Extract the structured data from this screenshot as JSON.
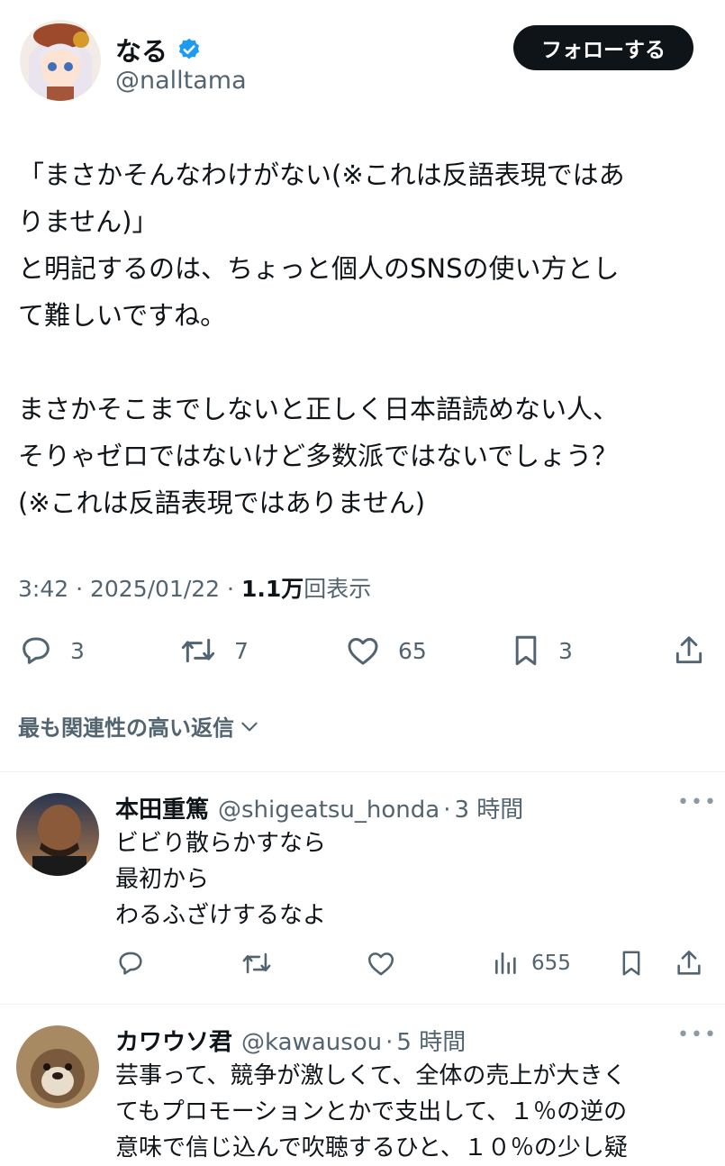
{
  "author": {
    "name": "なる",
    "handle": "@nalltama",
    "verified": true,
    "follow_label": "フォローする"
  },
  "tweet": {
    "line1": "「まさかそんなわけがない(※これは反語表現ではあ",
    "line2": "りません)」",
    "line3": "と明記するのは、ちょっと個人のSNSの使い方とし",
    "line4": "て難しいですね。",
    "line5": "まさかそこまでしないと正しく日本語読めない人、",
    "line6": "そりゃゼロではないけど多数派ではないでしょう？",
    "line7": "(※これは反語表現ではありません)",
    "time": "3:42",
    "date": "2025/01/22",
    "views_count": "1.1万",
    "views_label": "回表示",
    "sep": "·"
  },
  "stats": {
    "replies": "3",
    "retweets": "7",
    "likes": "65",
    "bookmarks": "3"
  },
  "related_label": "最も関連性の高い返信",
  "replies": [
    {
      "name": "本田重篤",
      "handle": "@shigeatsu_honda",
      "time": "3 時間",
      "lines": [
        "ビビり散らかすなら",
        "最初から",
        "わるふざけするなよ"
      ],
      "views": "655"
    },
    {
      "name": "カワウソ君",
      "handle": "@kawausou",
      "time": "5 時間",
      "lines": [
        "芸事って、競争が激しくて、全体の売上が大きく",
        "てもプロモーションとかで支出して、１％の逆の",
        "意味で信じ込んで吹聴するひと、１０％の少し疑"
      ]
    }
  ],
  "colors": {
    "text": "#0f1419",
    "muted": "#536471",
    "verified": "#1d9bf0",
    "button_bg": "#0f1419"
  },
  "icons": [
    "verified-badge-icon",
    "reply-icon",
    "retweet-icon",
    "like-icon",
    "bookmark-icon",
    "share-icon",
    "chevron-down-icon",
    "views-icon",
    "more-icon"
  ]
}
